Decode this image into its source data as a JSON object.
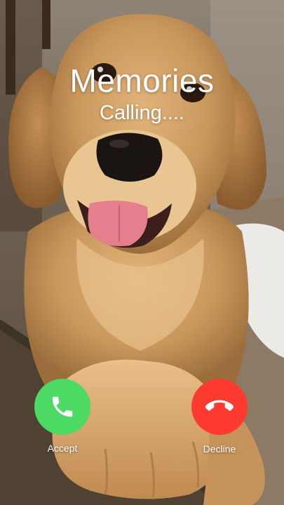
{
  "caller": {
    "name": "Memories",
    "status": "Calling...."
  },
  "actions": {
    "accept_label": "Accept",
    "decline_label": "Decline"
  },
  "icons": {
    "accept": "phone-icon",
    "decline": "hang-up-icon"
  },
  "colors": {
    "accept": "#4cd964",
    "decline": "#ff3b30",
    "text": "#ffffff"
  }
}
